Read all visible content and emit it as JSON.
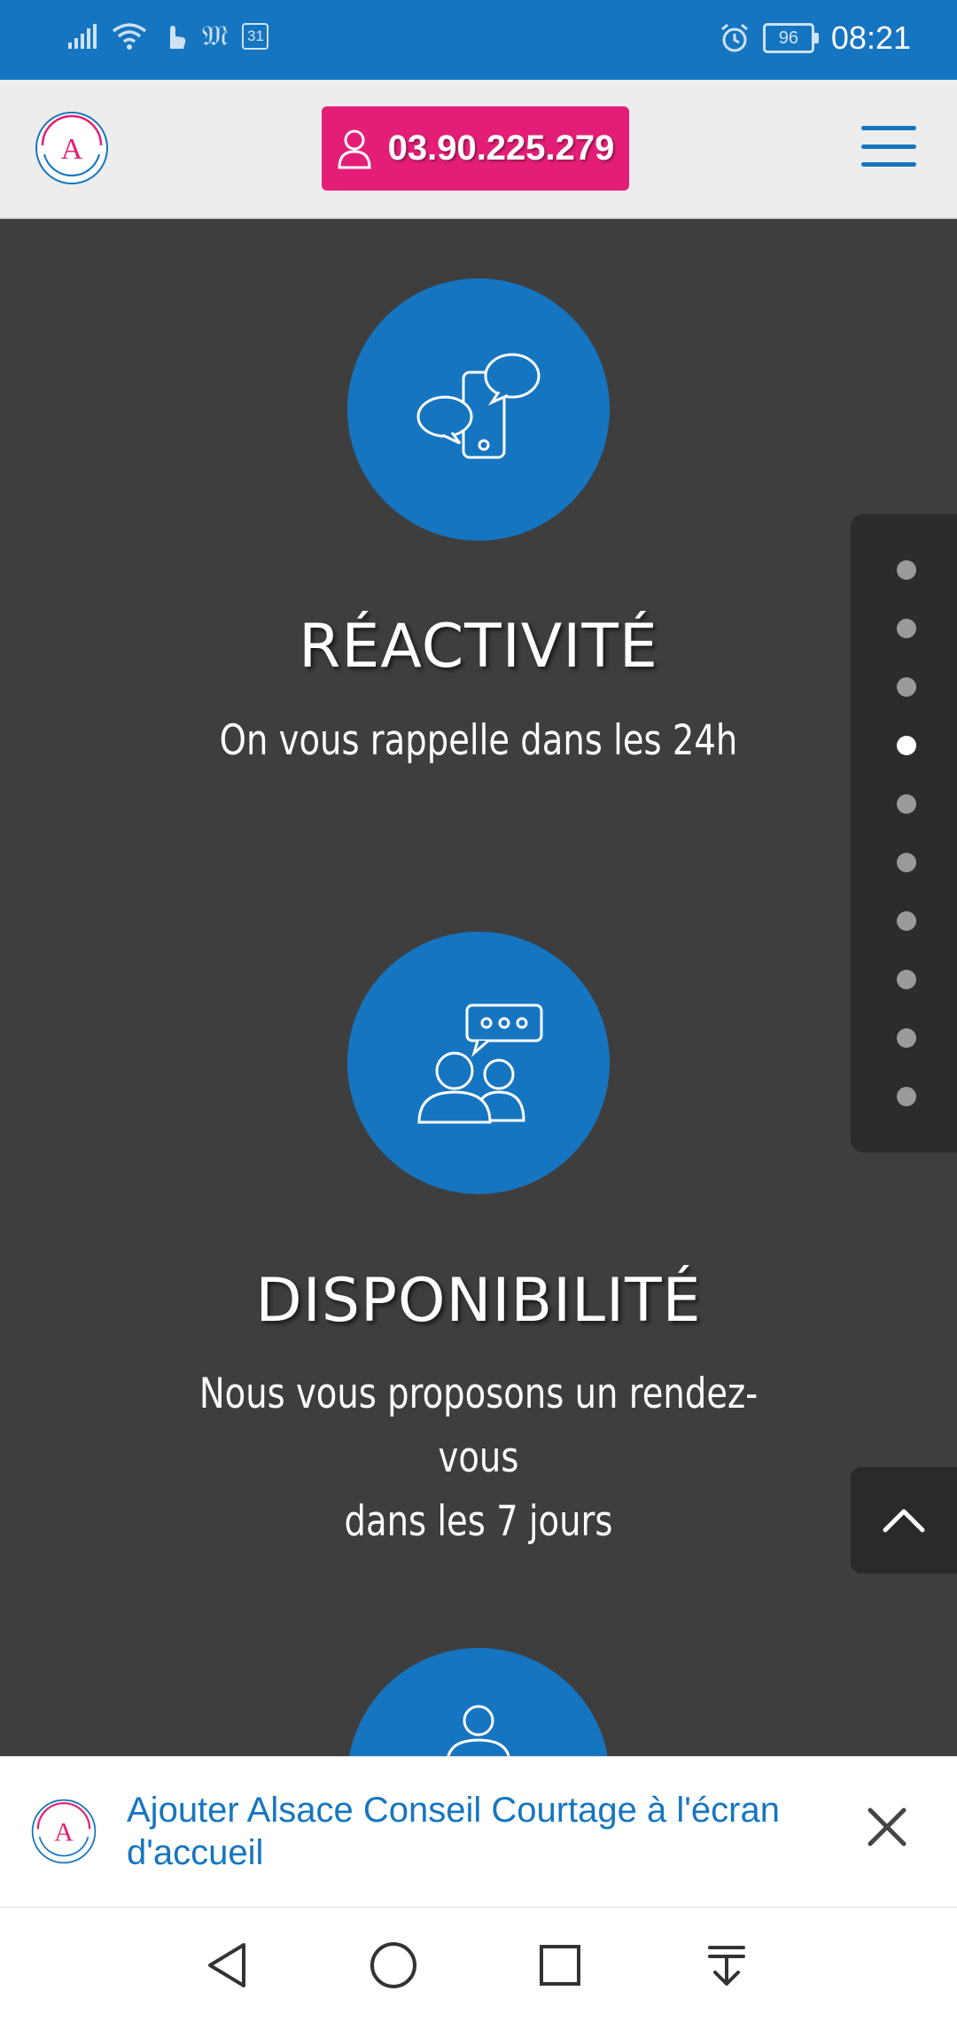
{
  "status_bar": {
    "time": "08:21",
    "battery": "96",
    "calendar_day": "31",
    "left_icons": [
      "signal-icon",
      "wifi-icon",
      "touch-icon",
      "newspaper-icon",
      "calendar-icon"
    ],
    "right_icons": [
      "alarm-icon",
      "battery-icon"
    ]
  },
  "header": {
    "phone": "03.90.225.279",
    "phone_icon": "user-icon",
    "menu_icon": "hamburger-menu-icon",
    "brand_color": "#1675c0",
    "accent_color": "#e41e77"
  },
  "features": [
    {
      "icon": "phone-chat-bubbles-icon",
      "title": "RÉACTIVITÉ",
      "lines": [
        "On vous rappelle dans les 24h"
      ]
    },
    {
      "icon": "people-conversation-icon",
      "title": "DISPONIBILITÉ",
      "lines": [
        "Nous vous proposons un rendez-vous",
        "dans les 7 jours"
      ]
    },
    {
      "icon": "person-icon"
    }
  ],
  "pagination": {
    "total": 10,
    "active_index": 3
  },
  "back_to_top_icon": "chevron-up-icon",
  "banner": {
    "text": "Ajouter Alsace Conseil Courtage à l'écran d'accueil",
    "close_icon": "close-icon"
  },
  "nav_bar": {
    "icons": [
      "back-triangle-icon",
      "home-circle-icon",
      "recents-square-icon",
      "notification-pull-icon"
    ]
  }
}
